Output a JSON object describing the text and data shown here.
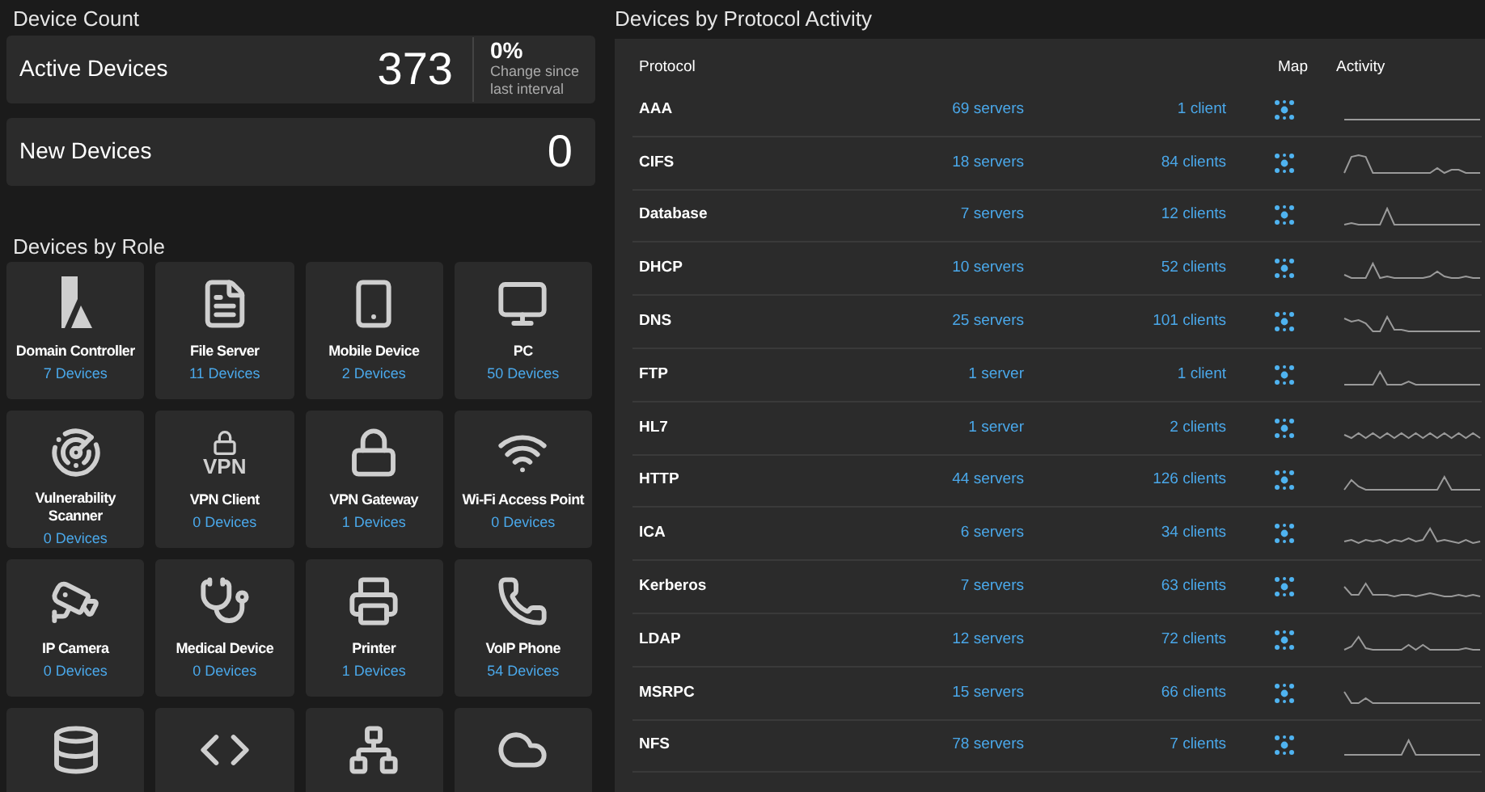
{
  "device_count": {
    "title": "Device Count",
    "active": {
      "label": "Active Devices",
      "value": "373",
      "change": "0%",
      "change_caption": "Change since last interval"
    },
    "new": {
      "label": "New Devices",
      "value": "0"
    }
  },
  "roles": {
    "title": "Devices by Role",
    "items": [
      {
        "kind": "tile",
        "label": "Domain Controller",
        "count": "7 Devices"
      },
      {
        "kind": "tile",
        "label": "File Server",
        "count": "11 Devices"
      },
      {
        "kind": "tile",
        "label": "Mobile Device",
        "count": "2 Devices"
      },
      {
        "kind": "tile",
        "label": "PC",
        "count": "50 Devices"
      },
      {
        "kind": "tile",
        "label": "Vulnerability Scanner",
        "count": "0 Devices"
      },
      {
        "kind": "tile",
        "label": "VPN Client",
        "count": "0 Devices",
        "icon_text": "VPN"
      },
      {
        "kind": "tile",
        "label": "VPN Gateway",
        "count": "1 Devices"
      },
      {
        "kind": "tile",
        "label": "Wi-Fi Access Point",
        "count": "0 Devices"
      },
      {
        "kind": "tile",
        "label": "IP Camera",
        "count": "0 Devices"
      },
      {
        "kind": "tile",
        "label": "Medical Device",
        "count": "0 Devices"
      },
      {
        "kind": "tile",
        "label": "Printer",
        "count": "1 Devices"
      },
      {
        "kind": "tile",
        "label": "VoIP Phone",
        "count": "54 Devices"
      },
      {
        "kind": "cut"
      },
      {
        "kind": "cut"
      },
      {
        "kind": "cut"
      },
      {
        "kind": "cut"
      }
    ]
  },
  "protocols": {
    "title": "Devices by Protocol Activity",
    "columns": [
      "Protocol",
      "Map",
      "Activity"
    ],
    "rows": [
      {
        "protocol": "AAA",
        "servers": "69 servers",
        "clients": "1 client"
      },
      {
        "protocol": "CIFS",
        "servers": "18 servers",
        "clients": "84 clients"
      },
      {
        "protocol": "Database",
        "servers": "7 servers",
        "clients": "12 clients"
      },
      {
        "protocol": "DHCP",
        "servers": "10 servers",
        "clients": "52 clients"
      },
      {
        "protocol": "DNS",
        "servers": "25 servers",
        "clients": "101 clients"
      },
      {
        "protocol": "FTP",
        "servers": "1 server",
        "clients": "1 client"
      },
      {
        "protocol": "HL7",
        "servers": "1 server",
        "clients": "2 clients"
      },
      {
        "protocol": "HTTP",
        "servers": "44 servers",
        "clients": "126 clients"
      },
      {
        "protocol": "ICA",
        "servers": "6 servers",
        "clients": "34 clients"
      },
      {
        "protocol": "Kerberos",
        "servers": "7 servers",
        "clients": "63 clients"
      },
      {
        "protocol": "LDAP",
        "servers": "12 servers",
        "clients": "72 clients"
      },
      {
        "protocol": "MSRPC",
        "servers": "15 servers",
        "clients": "66 clients"
      },
      {
        "protocol": "NFS",
        "servers": "78 servers",
        "clients": "7 clients"
      }
    ]
  }
}
